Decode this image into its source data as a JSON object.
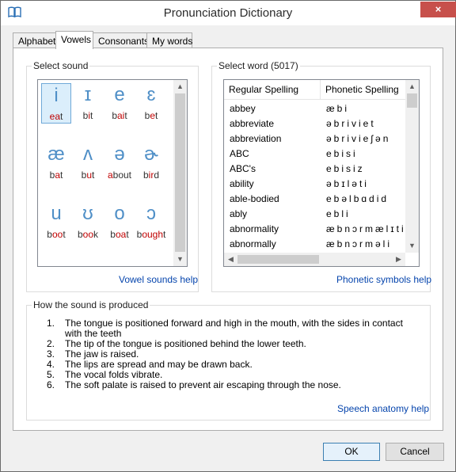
{
  "window": {
    "title": "Pronunciation Dictionary",
    "close_glyph": "×"
  },
  "tabs": [
    {
      "label": "Alphabet"
    },
    {
      "label": "Vowels",
      "active": true
    },
    {
      "label": "Consonants"
    },
    {
      "label": "My words"
    }
  ],
  "select_sound": {
    "title": "Select sound",
    "help_link": "Vowel sounds help",
    "sounds": [
      {
        "symbol": "i",
        "pre": "",
        "hl": "ea",
        "post": "t",
        "selected": true
      },
      {
        "symbol": "ɪ",
        "pre": "b",
        "hl": "i",
        "post": "t"
      },
      {
        "symbol": "e",
        "pre": "b",
        "hl": "ai",
        "post": "t"
      },
      {
        "symbol": "ɛ",
        "pre": "b",
        "hl": "e",
        "post": "t"
      },
      {
        "symbol": "æ",
        "pre": "b",
        "hl": "a",
        "post": "t"
      },
      {
        "symbol": "ʌ",
        "pre": "b",
        "hl": "u",
        "post": "t"
      },
      {
        "symbol": "ə",
        "pre": "",
        "hl": "a",
        "post": "bout"
      },
      {
        "symbol": "ɚ",
        "pre": "b",
        "hl": "ir",
        "post": "d"
      },
      {
        "symbol": "u",
        "pre": "b",
        "hl": "oo",
        "post": "t"
      },
      {
        "symbol": "ʊ",
        "pre": "b",
        "hl": "oo",
        "post": "k"
      },
      {
        "symbol": "o",
        "pre": "b",
        "hl": "oa",
        "post": "t"
      },
      {
        "symbol": "ɔ",
        "pre": "b",
        "hl": "ough",
        "post": "t"
      }
    ]
  },
  "select_word": {
    "title": "Select word (5017)",
    "help_link": "Phonetic symbols help",
    "columns": [
      "Regular Spelling",
      "Phonetic Spelling"
    ],
    "rows": [
      [
        "abbey",
        "æbi"
      ],
      [
        "abbreviate",
        "əbriviet"
      ],
      [
        "abbreviation",
        "əbrivieʃən"
      ],
      [
        "ABC",
        "ebisi"
      ],
      [
        "ABC's",
        "ebisiz"
      ],
      [
        "ability",
        "əbɪləti"
      ],
      [
        "able-bodied",
        "ebəlbɑdid"
      ],
      [
        "ably",
        "ebli"
      ],
      [
        "abnormality",
        "æbnɔrmælɪti"
      ],
      [
        "abnormally",
        "æbnɔrməli"
      ]
    ]
  },
  "how_produced": {
    "title": "How the sound is produced",
    "help_link": "Speech anatomy help",
    "steps": [
      {
        "num": "1.",
        "text": "The tongue is positioned forward and high in the mouth, with the sides in contact with the teeth"
      },
      {
        "num": "2.",
        "text": "The tip of the tongue is positioned behind the lower teeth."
      },
      {
        "num": "3.",
        "text": "The jaw is raised."
      },
      {
        "num": "4.",
        "text": "The lips are spread and may be drawn back."
      },
      {
        "num": "5.",
        "text": "The vocal folds vibrate."
      },
      {
        "num": "6.",
        "text": "The soft palate is raised to prevent air escaping through the nose."
      }
    ]
  },
  "buttons": {
    "ok": "OK",
    "cancel": "Cancel"
  },
  "colors": {
    "symbol": "#4f8fc7",
    "highlight": "#c00000",
    "link": "#0645ad",
    "close": "#c7504b"
  }
}
